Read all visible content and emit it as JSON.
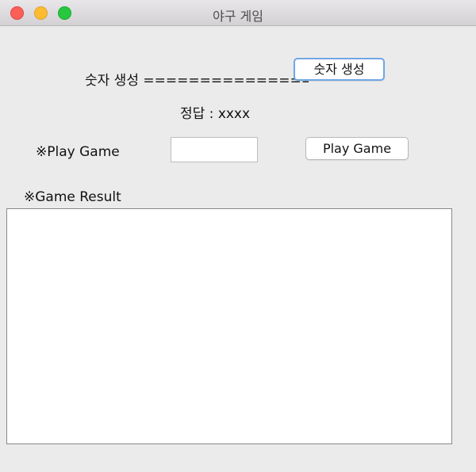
{
  "window": {
    "title": "야구 게임"
  },
  "generate": {
    "label": "숫자 생성 ===================================",
    "button_label": "숫자 생성"
  },
  "answer": {
    "label": "정답 : xxxx"
  },
  "play": {
    "label": "※Play Game",
    "input_value": "",
    "button_label": "Play Game"
  },
  "result": {
    "label": "※Game Result",
    "text": ""
  }
}
